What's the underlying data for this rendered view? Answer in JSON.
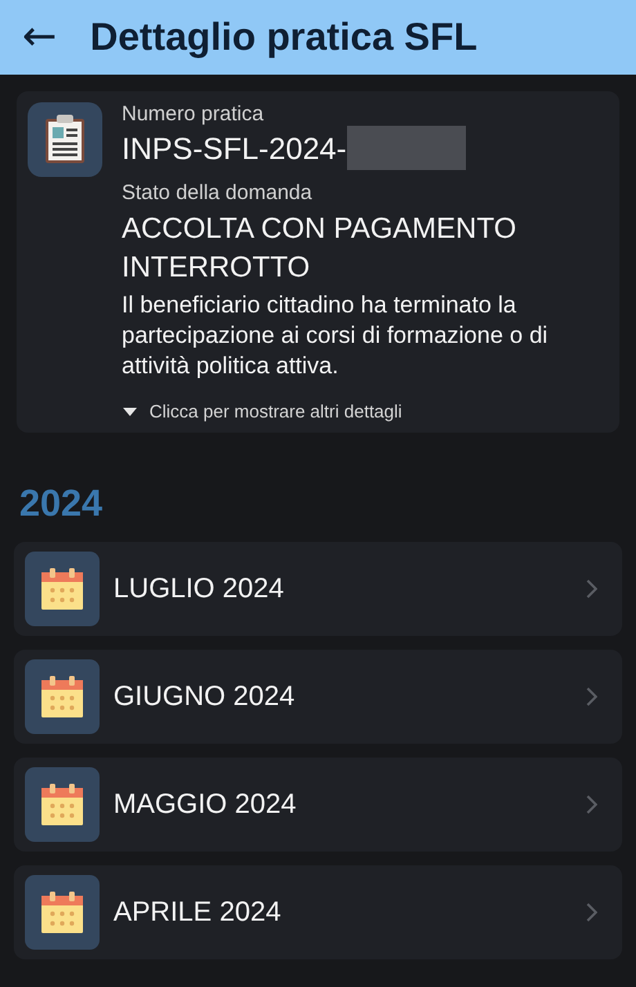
{
  "header": {
    "back_icon": "←",
    "title": "Dettaglio pratica SFL"
  },
  "summary": {
    "number_label": "Numero pratica",
    "number": "INPS-SFL-2024-",
    "number_redacted": true,
    "status_label": "Stato della domanda",
    "status": "ACCOLTA CON PAGAMENTO INTERROTTO",
    "description": "Il beneficiario cittadino ha terminato la partecipazione ai corsi di formazione o di attività politica attiva.",
    "details_toggle": {
      "label": "Clicca per mostrare altri dettagli",
      "expanded": false
    }
  },
  "year": "2024",
  "months": [
    {
      "label": "LUGLIO 2024"
    },
    {
      "label": "GIUGNO 2024"
    },
    {
      "label": "MAGGIO 2024"
    },
    {
      "label": "APRILE 2024"
    }
  ]
}
